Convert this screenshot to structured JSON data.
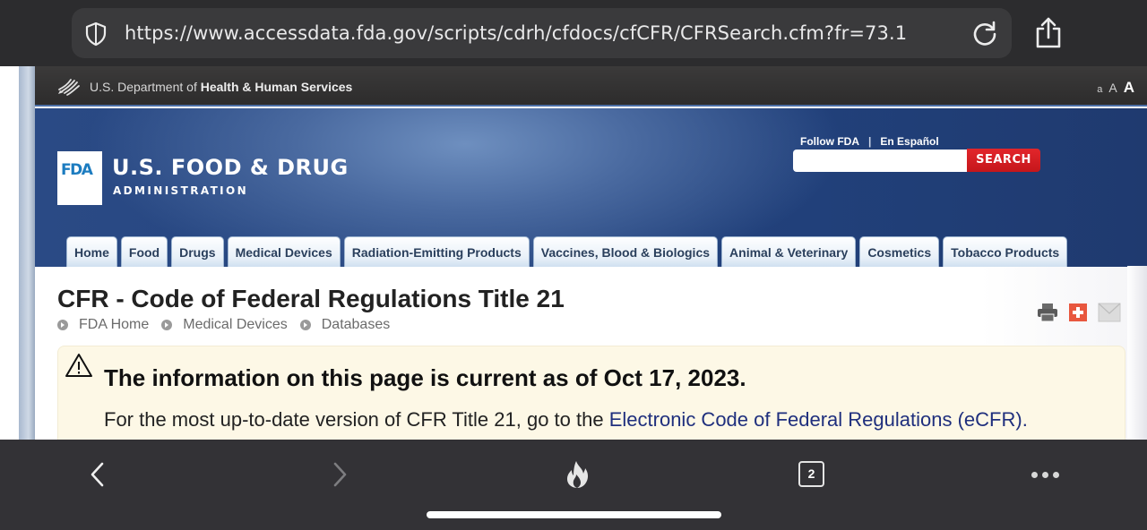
{
  "browser": {
    "url": "https://www.accessdata.fda.gov/scripts/cdrh/cfdocs/cfCFR/CFRSearch.cfm?fr=73.1",
    "security_icon": "shield-icon",
    "reload_icon": "reload-icon",
    "share_icon": "share-icon",
    "tab_count": "2",
    "toolbar_icons": [
      "back-icon",
      "forward-icon",
      "flame-icon",
      "tabs-icon",
      "more-icon"
    ]
  },
  "hhs": {
    "prefix": "U.S. Department of",
    "name": "Health & Human Services",
    "text_sizes": [
      "a",
      "A",
      "A"
    ]
  },
  "header": {
    "logo_text": "FDA",
    "title": "U.S. FOOD & DRUG",
    "subtitle": "ADMINISTRATION",
    "follow_label": "Follow FDA",
    "separator": "|",
    "espanol_label": "En Español",
    "search_placeholder": "",
    "search_button": "SEARCH"
  },
  "nav": {
    "tabs": [
      {
        "label": "Home"
      },
      {
        "label": "Food"
      },
      {
        "label": "Drugs"
      },
      {
        "label": "Medical Devices"
      },
      {
        "label": "Radiation-Emitting Products"
      },
      {
        "label": "Vaccines, Blood & Biologics"
      },
      {
        "label": "Animal & Veterinary"
      },
      {
        "label": "Cosmetics"
      },
      {
        "label": "Tobacco Products"
      }
    ]
  },
  "content": {
    "title": "CFR - Code of Federal Regulations Title 21",
    "breadcrumb": [
      "FDA Home",
      "Medical Devices",
      "Databases"
    ],
    "page_icons": [
      "print-icon",
      "add-icon",
      "email-icon"
    ],
    "notice": {
      "heading": "The information on this page is current as of Oct 17, 2023.",
      "body_prefix": "For the most up-to-date version of CFR Title 21, go to the ",
      "link_text": "Electronic Code of Federal Regulations (eCFR)."
    }
  },
  "colors": {
    "banner_blue": "#21407a",
    "search_red": "#d41d22",
    "notice_bg": "#fdf8e6",
    "link_blue": "#1f2f7d"
  }
}
